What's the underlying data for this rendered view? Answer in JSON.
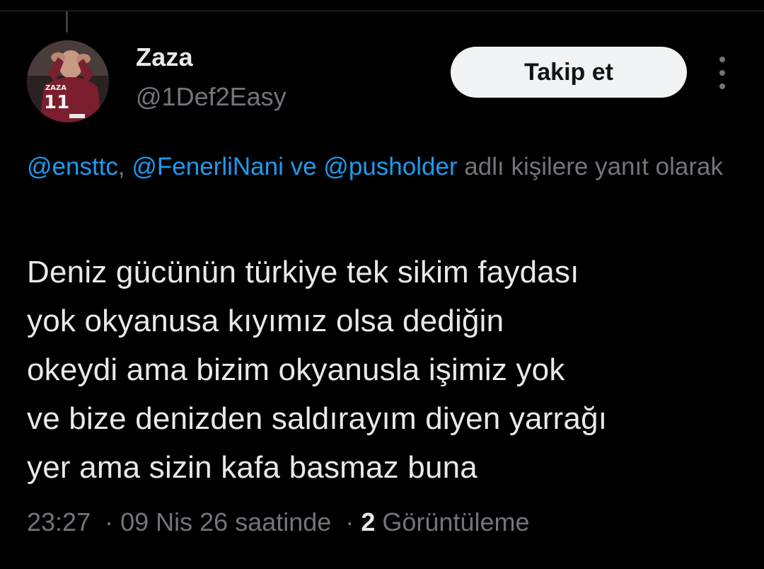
{
  "colors": {
    "background": "#000000",
    "primary_text": "#e7e9ea",
    "secondary_text": "#71767b",
    "link": "#1d9bf0",
    "follow_button_bg": "#eff3f4",
    "follow_button_text": "#0f1419"
  },
  "author": {
    "display_name": "Zaza",
    "handle": "@1Def2Easy",
    "avatar_icon": "footballer-avatar"
  },
  "follow_button_label": "Takip et",
  "more_icon": "more-vertical-icon",
  "reply_context": {
    "mentions": [
      "@ensttc",
      "@FenerliNani",
      "@pusholder"
    ],
    "sep_comma": ", ",
    "sep_and": " ve ",
    "suffix": " adlı kişilere yanıt olarak"
  },
  "tweet": {
    "lines": [
      "Deniz gücünün türkiye tek sikim faydası",
      "yok okyanusa kıyımız olsa dediğin",
      "okeydi ama bizim okyanusla işimiz yok",
      "ve bize denizden saldırayım diyen yarrağı",
      "yer ama sizin kafa basmaz buna"
    ]
  },
  "meta": {
    "time": "23:27",
    "dot": "·",
    "date_phrase": "09 Nis 26 saatinde",
    "views_count": "2",
    "views_label": "Görüntüleme"
  }
}
